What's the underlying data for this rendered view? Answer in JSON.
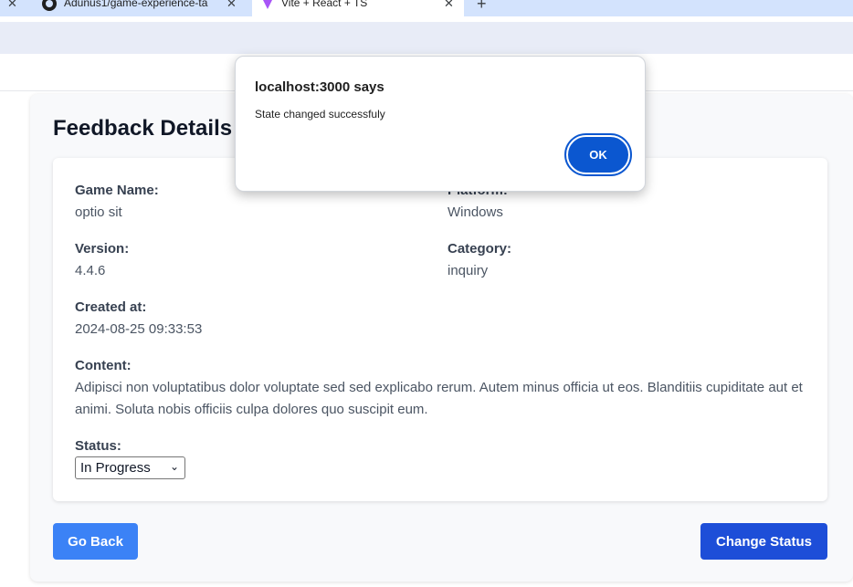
{
  "browser": {
    "tabs": [
      {
        "title": "Adunus1/game-experience-ta"
      },
      {
        "title": "Vite + React + TS"
      }
    ],
    "new_tab_symbol": "+",
    "close_symbol": "✕"
  },
  "page": {
    "title": "Feedback Details",
    "fields": {
      "game_name": {
        "label": "Game Name:",
        "value": "optio sit"
      },
      "platform": {
        "label": "Platform:",
        "value": "Windows"
      },
      "version": {
        "label": "Version:",
        "value": "4.4.6"
      },
      "category": {
        "label": "Category:",
        "value": "inquiry"
      },
      "created_at": {
        "label": "Created at:",
        "value": "2024-08-25 09:33:53"
      },
      "content": {
        "label": "Content:",
        "value": "Adipisci non voluptatibus dolor voluptate sed sed explicabo rerum. Autem minus officia ut eos. Blanditiis cupiditate aut et animi. Soluta nobis officiis culpa dolores quo suscipit eum."
      },
      "status": {
        "label": "Status:",
        "value": "In Progress"
      }
    },
    "buttons": {
      "back": "Go Back",
      "change_status": "Change Status"
    }
  },
  "dialog": {
    "title": "localhost:3000 says",
    "message": "State changed successfuly",
    "ok_label": "OK"
  },
  "colors": {
    "primary_button": "#3b82f6",
    "dark_button": "#1d4ed8",
    "dialog_button": "#0b57d0"
  }
}
